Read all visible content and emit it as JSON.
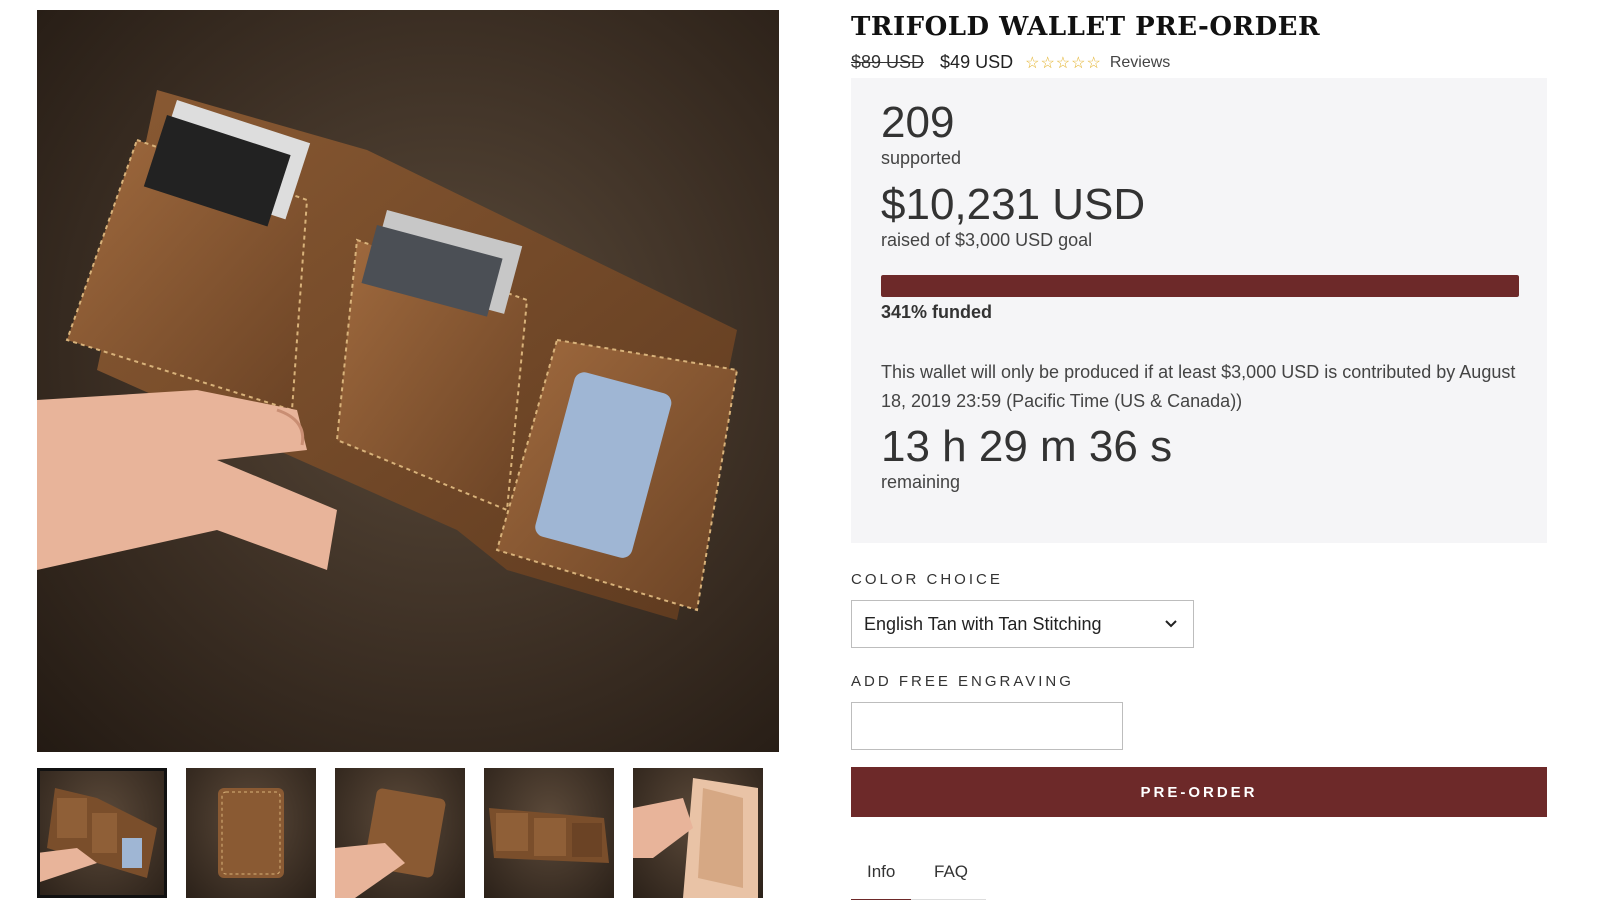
{
  "product": {
    "title": "TRIFOLD WALLET PRE-ORDER",
    "old_price": "$89 USD",
    "price": "$49 USD",
    "stars": "☆☆☆☆☆",
    "reviews_label": "Reviews"
  },
  "campaign": {
    "supporters_count": "209",
    "supporters_label": "supported",
    "raised_amount": "$10,231 USD",
    "raised_label": "raised of $3,000 USD goal",
    "funded_percent": 341,
    "progress_fill_fraction": 1.0,
    "funded_label": "341% funded",
    "notice": "This wallet will only be produced if at least $3,000 USD is contributed by August 18, 2019 23:59 (Pacific Time (US & Canada))",
    "countdown": "13 h 29 m 36 s",
    "countdown_label": "remaining"
  },
  "options": {
    "color_label": "COLOR CHOICE",
    "color_selected": "English Tan with Tan Stitching",
    "engraving_label": "ADD FREE ENGRAVING",
    "engraving_value": ""
  },
  "actions": {
    "preorder_label": "PRE-ORDER"
  },
  "tabs": [
    {
      "label": "Info",
      "active": true
    },
    {
      "label": "FAQ",
      "active": false
    }
  ],
  "gallery": {
    "thumbnail_count": 5,
    "selected_index": 0
  },
  "colors": {
    "accent": "#6d2929",
    "panel_bg": "#f5f5f7",
    "star": "#e3b22a"
  },
  "icons": [
    "chevron-down-icon"
  ]
}
